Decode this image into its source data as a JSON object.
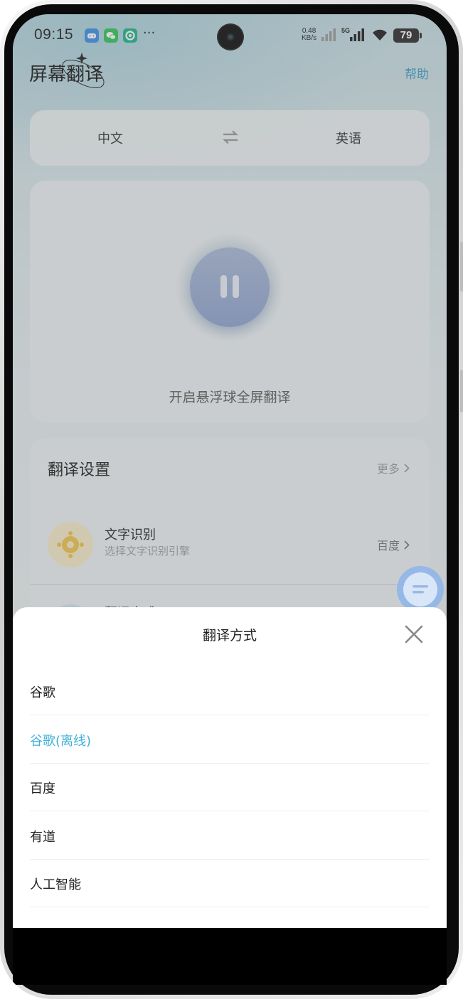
{
  "status_bar": {
    "time": "09:15",
    "apps": [
      {
        "icon": "game-app-icon",
        "color": "#3b8fe8"
      },
      {
        "icon": "wechat-icon",
        "color": "#2ec55a"
      },
      {
        "icon": "recycle-app-icon",
        "color": "#1fb389"
      }
    ],
    "more": "···",
    "net_speed_value": "0.48",
    "net_speed_unit": "KB/s",
    "network_type": "5G",
    "battery": "79"
  },
  "header": {
    "title": "屏幕翻译",
    "help": "帮助"
  },
  "language": {
    "source": "中文",
    "target": "英语"
  },
  "float_ball": {
    "label": "开启悬浮球全屏翻译"
  },
  "settings": {
    "title": "翻译设置",
    "more": "更多",
    "items": [
      {
        "label": "文字识别",
        "sub": "选择文字识别引擎",
        "value": "百度"
      },
      {
        "label": "翻译方式"
      }
    ]
  },
  "sheet": {
    "title": "翻译方式",
    "options": [
      {
        "label": "谷歌",
        "selected": false
      },
      {
        "label": "谷歌(离线)",
        "selected": true
      },
      {
        "label": "百度",
        "selected": false
      },
      {
        "label": "有道",
        "selected": false
      },
      {
        "label": "人工智能",
        "selected": false
      }
    ]
  },
  "colors": {
    "accent": "#3fb0d8",
    "help_link": "#3a9fc7",
    "float_button": "#8ea3cf",
    "chat_bubble": "#8cb4eb"
  }
}
